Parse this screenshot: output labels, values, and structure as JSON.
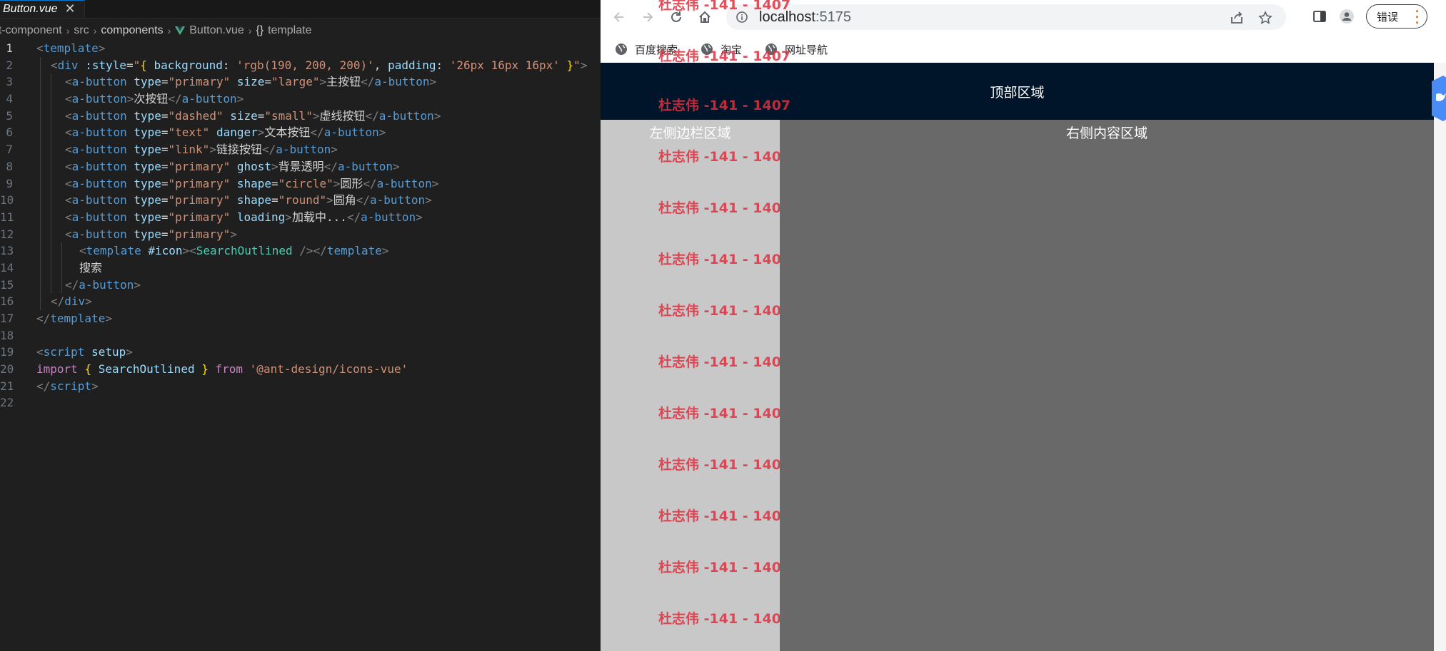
{
  "editor": {
    "tab": {
      "name": "Button.vue",
      "close": "✕"
    },
    "breadcrumb": {
      "project": "ant-component",
      "src": "src",
      "components": "components",
      "file": "Button.vue",
      "braces": "{}",
      "symbol": "template"
    },
    "code_lines": [
      {
        "n": "1",
        "indent": 0,
        "tokens": [
          [
            "brk",
            "<"
          ],
          [
            "tag",
            "template"
          ],
          [
            "brk",
            ">"
          ]
        ]
      },
      {
        "n": "2",
        "indent": 1,
        "tokens": [
          [
            "brk",
            "<"
          ],
          [
            "tag",
            "div"
          ],
          [
            "text",
            " "
          ],
          [
            "attr",
            ":style"
          ],
          [
            "text",
            "="
          ],
          [
            "str",
            "\""
          ],
          [
            "brace",
            "{"
          ],
          [
            "attr",
            " background"
          ],
          [
            "text",
            ": "
          ],
          [
            "str",
            "'rgb(190, 200, 200)'"
          ],
          [
            "text",
            ", "
          ],
          [
            "attr",
            "padding"
          ],
          [
            "text",
            ": "
          ],
          [
            "str",
            "'26px 16px 16px'"
          ],
          [
            "text",
            " "
          ],
          [
            "brace",
            "}"
          ],
          [
            "str",
            "\""
          ],
          [
            "brk",
            ">"
          ]
        ]
      },
      {
        "n": "3",
        "indent": 2,
        "tokens": [
          [
            "brk",
            "<"
          ],
          [
            "tag",
            "a-button"
          ],
          [
            "text",
            " "
          ],
          [
            "attr",
            "type"
          ],
          [
            "text",
            "="
          ],
          [
            "str",
            "\"primary\""
          ],
          [
            "text",
            " "
          ],
          [
            "attr",
            "size"
          ],
          [
            "text",
            "="
          ],
          [
            "str",
            "\"large\""
          ],
          [
            "brk",
            ">"
          ],
          [
            "text",
            "主按钮"
          ],
          [
            "brk",
            "</"
          ],
          [
            "tag",
            "a-button"
          ],
          [
            "brk",
            ">"
          ]
        ]
      },
      {
        "n": "4",
        "indent": 2,
        "tokens": [
          [
            "brk",
            "<"
          ],
          [
            "tag",
            "a-button"
          ],
          [
            "brk",
            ">"
          ],
          [
            "text",
            "次按钮"
          ],
          [
            "brk",
            "</"
          ],
          [
            "tag",
            "a-button"
          ],
          [
            "brk",
            ">"
          ]
        ]
      },
      {
        "n": "5",
        "indent": 2,
        "tokens": [
          [
            "brk",
            "<"
          ],
          [
            "tag",
            "a-button"
          ],
          [
            "text",
            " "
          ],
          [
            "attr",
            "type"
          ],
          [
            "text",
            "="
          ],
          [
            "str",
            "\"dashed\""
          ],
          [
            "text",
            " "
          ],
          [
            "attr",
            "size"
          ],
          [
            "text",
            "="
          ],
          [
            "str",
            "\"small\""
          ],
          [
            "brk",
            ">"
          ],
          [
            "text",
            "虚线按钮"
          ],
          [
            "brk",
            "</"
          ],
          [
            "tag",
            "a-button"
          ],
          [
            "brk",
            ">"
          ]
        ]
      },
      {
        "n": "6",
        "indent": 2,
        "tokens": [
          [
            "brk",
            "<"
          ],
          [
            "tag",
            "a-button"
          ],
          [
            "text",
            " "
          ],
          [
            "attr",
            "type"
          ],
          [
            "text",
            "="
          ],
          [
            "str",
            "\"text\""
          ],
          [
            "text",
            " "
          ],
          [
            "attr",
            "danger"
          ],
          [
            "brk",
            ">"
          ],
          [
            "text",
            "文本按钮"
          ],
          [
            "brk",
            "</"
          ],
          [
            "tag",
            "a-button"
          ],
          [
            "brk",
            ">"
          ]
        ]
      },
      {
        "n": "7",
        "indent": 2,
        "tokens": [
          [
            "brk",
            "<"
          ],
          [
            "tag",
            "a-button"
          ],
          [
            "text",
            " "
          ],
          [
            "attr",
            "type"
          ],
          [
            "text",
            "="
          ],
          [
            "str",
            "\"link\""
          ],
          [
            "brk",
            ">"
          ],
          [
            "text",
            "链接按钮"
          ],
          [
            "brk",
            "</"
          ],
          [
            "tag",
            "a-button"
          ],
          [
            "brk",
            ">"
          ]
        ]
      },
      {
        "n": "8",
        "indent": 2,
        "tokens": [
          [
            "brk",
            "<"
          ],
          [
            "tag",
            "a-button"
          ],
          [
            "text",
            " "
          ],
          [
            "attr",
            "type"
          ],
          [
            "text",
            "="
          ],
          [
            "str",
            "\"primary\""
          ],
          [
            "text",
            " "
          ],
          [
            "attr",
            "ghost"
          ],
          [
            "brk",
            ">"
          ],
          [
            "text",
            "背景透明"
          ],
          [
            "brk",
            "</"
          ],
          [
            "tag",
            "a-button"
          ],
          [
            "brk",
            ">"
          ]
        ]
      },
      {
        "n": "9",
        "indent": 2,
        "tokens": [
          [
            "brk",
            "<"
          ],
          [
            "tag",
            "a-button"
          ],
          [
            "text",
            " "
          ],
          [
            "attr",
            "type"
          ],
          [
            "text",
            "="
          ],
          [
            "str",
            "\"primary\""
          ],
          [
            "text",
            " "
          ],
          [
            "attr",
            "shape"
          ],
          [
            "text",
            "="
          ],
          [
            "str",
            "\"circle\""
          ],
          [
            "brk",
            ">"
          ],
          [
            "text",
            "圆形"
          ],
          [
            "brk",
            "</"
          ],
          [
            "tag",
            "a-button"
          ],
          [
            "brk",
            ">"
          ]
        ]
      },
      {
        "n": "10",
        "indent": 2,
        "tokens": [
          [
            "brk",
            "<"
          ],
          [
            "tag",
            "a-button"
          ],
          [
            "text",
            " "
          ],
          [
            "attr",
            "type"
          ],
          [
            "text",
            "="
          ],
          [
            "str",
            "\"primary\""
          ],
          [
            "text",
            " "
          ],
          [
            "attr",
            "shape"
          ],
          [
            "text",
            "="
          ],
          [
            "str",
            "\"round\""
          ],
          [
            "brk",
            ">"
          ],
          [
            "text",
            "圆角"
          ],
          [
            "brk",
            "</"
          ],
          [
            "tag",
            "a-button"
          ],
          [
            "brk",
            ">"
          ]
        ]
      },
      {
        "n": "11",
        "indent": 2,
        "tokens": [
          [
            "brk",
            "<"
          ],
          [
            "tag",
            "a-button"
          ],
          [
            "text",
            " "
          ],
          [
            "attr",
            "type"
          ],
          [
            "text",
            "="
          ],
          [
            "str",
            "\"primary\""
          ],
          [
            "text",
            " "
          ],
          [
            "attr",
            "loading"
          ],
          [
            "brk",
            ">"
          ],
          [
            "text",
            "加载中..."
          ],
          [
            "brk",
            "</"
          ],
          [
            "tag",
            "a-button"
          ],
          [
            "brk",
            ">"
          ]
        ]
      },
      {
        "n": "12",
        "indent": 2,
        "tokens": [
          [
            "brk",
            "<"
          ],
          [
            "tag",
            "a-button"
          ],
          [
            "text",
            " "
          ],
          [
            "attr",
            "type"
          ],
          [
            "text",
            "="
          ],
          [
            "str",
            "\"primary\""
          ],
          [
            "brk",
            ">"
          ]
        ]
      },
      {
        "n": "13",
        "indent": 3,
        "tokens": [
          [
            "brk",
            "<"
          ],
          [
            "tag",
            "template"
          ],
          [
            "text",
            " "
          ],
          [
            "attr",
            "#icon"
          ],
          [
            "brk",
            "><"
          ],
          [
            "comp",
            "SearchOutlined"
          ],
          [
            "text",
            " "
          ],
          [
            "brk",
            "/></"
          ],
          [
            "tag",
            "template"
          ],
          [
            "brk",
            ">"
          ]
        ]
      },
      {
        "n": "14",
        "indent": 3,
        "tokens": [
          [
            "text",
            "搜索"
          ]
        ]
      },
      {
        "n": "15",
        "indent": 2,
        "tokens": [
          [
            "brk",
            "</"
          ],
          [
            "tag",
            "a-button"
          ],
          [
            "brk",
            ">"
          ]
        ]
      },
      {
        "n": "16",
        "indent": 1,
        "tokens": [
          [
            "brk",
            "</"
          ],
          [
            "tag",
            "div"
          ],
          [
            "brk",
            ">"
          ]
        ]
      },
      {
        "n": "17",
        "indent": 0,
        "tokens": [
          [
            "brk",
            "</"
          ],
          [
            "tag",
            "template"
          ],
          [
            "brk",
            ">"
          ]
        ]
      },
      {
        "n": "18",
        "indent": 0,
        "tokens": []
      },
      {
        "n": "19",
        "indent": 0,
        "tokens": [
          [
            "brk",
            "<"
          ],
          [
            "tag",
            "script"
          ],
          [
            "text",
            " "
          ],
          [
            "attr",
            "setup"
          ],
          [
            "brk",
            ">"
          ]
        ]
      },
      {
        "n": "20",
        "indent": 0,
        "tokens": [
          [
            "kw",
            "import"
          ],
          [
            "text",
            " "
          ],
          [
            "brace",
            "{"
          ],
          [
            "text",
            " "
          ],
          [
            "attr",
            "SearchOutlined"
          ],
          [
            "text",
            " "
          ],
          [
            "brace",
            "}"
          ],
          [
            "text",
            " "
          ],
          [
            "kw",
            "from"
          ],
          [
            "text",
            " "
          ],
          [
            "str",
            "'@ant-design/icons-vue'"
          ]
        ]
      },
      {
        "n": "21",
        "indent": 0,
        "tokens": [
          [
            "brk",
            "</"
          ],
          [
            "tag",
            "script"
          ],
          [
            "brk",
            ">"
          ]
        ]
      },
      {
        "n": "22",
        "indent": 0,
        "tokens": []
      }
    ]
  },
  "browser": {
    "url": {
      "host": "localhost",
      "port": ":5175"
    },
    "error_button_label": "错误",
    "bookmarks": [
      {
        "label": "百度搜索"
      },
      {
        "label": "淘宝"
      },
      {
        "label": "网址导航"
      }
    ],
    "page": {
      "header_text": "顶部区域",
      "sider_text": "左侧边栏区域",
      "content_text": "右侧内容区域"
    },
    "watermark_text": "杜志伟 -141 - 1407",
    "colors": {
      "header_bg": "#001529",
      "sider_bg": "#c8c8c8",
      "content_bg": "#696969",
      "watermark": "#e0303f"
    }
  }
}
